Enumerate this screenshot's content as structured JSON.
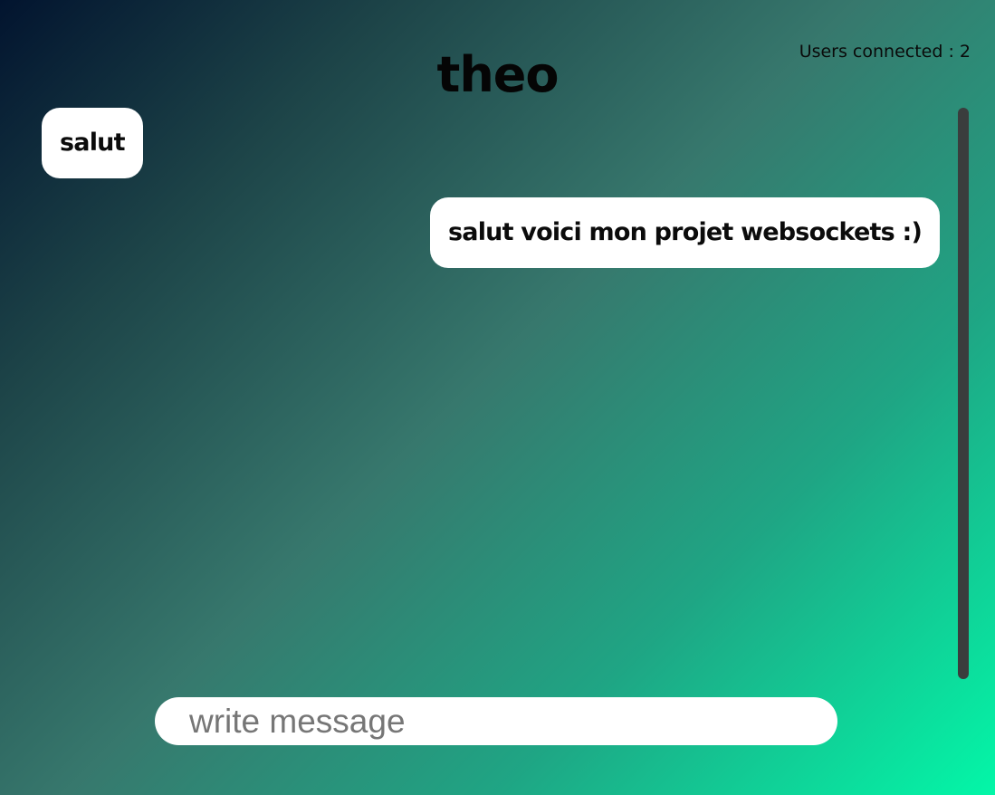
{
  "header": {
    "title": "theo",
    "users_connected_label": "Users connected : ",
    "users_connected_count": "2"
  },
  "messages": [
    {
      "text": "salut",
      "side": "left"
    },
    {
      "text": "salut voici mon projet websockets :)",
      "side": "right"
    }
  ],
  "composer": {
    "placeholder": "write message",
    "value": ""
  },
  "colors": {
    "bubble_bg": "#ffffff",
    "scrollbar": "#3a3d3d",
    "gradient_start": "#02142f",
    "gradient_end": "#03f7a8"
  }
}
